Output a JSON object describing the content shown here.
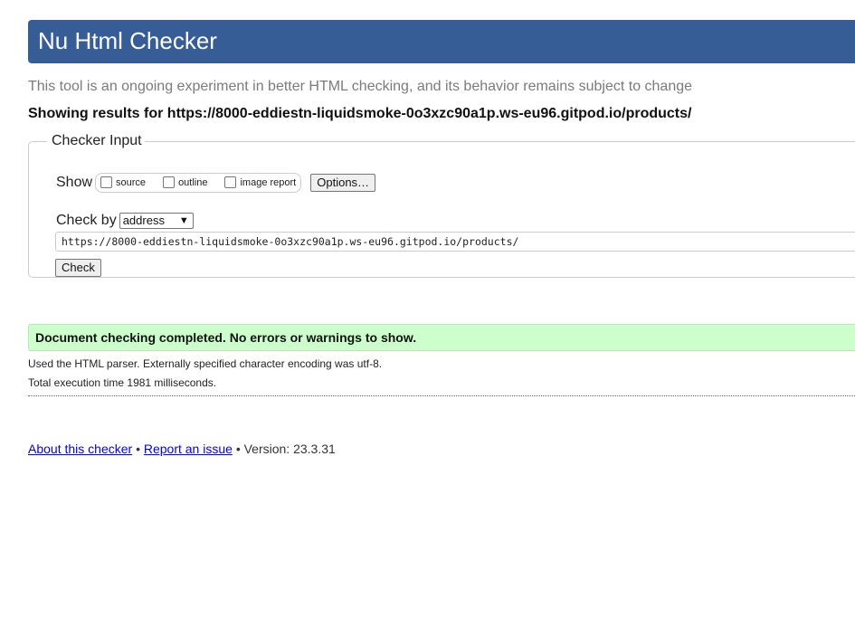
{
  "header": {
    "title": "Nu Html Checker"
  },
  "intro": "This tool is an ongoing experiment in better HTML checking, and its behavior remains subject to change",
  "results_heading": "Showing results for https://8000-eddiestn-liquidsmoke-0o3xzc90a1p.ws-eu96.gitpod.io/products/",
  "checker_input": {
    "legend": "Checker Input",
    "show_label": "Show",
    "checkboxes": [
      {
        "label": "source",
        "checked": false
      },
      {
        "label": "outline",
        "checked": false
      },
      {
        "label": "image report",
        "checked": false
      }
    ],
    "options_button": "Options…",
    "check_by_label": "Check by",
    "check_by_value": "address",
    "url_value": "https://8000-eddiestn-liquidsmoke-0o3xzc90a1p.ws-eu96.gitpod.io/products/",
    "check_button": "Check"
  },
  "result": {
    "message": "Document checking completed. No errors or warnings to show.",
    "message_bg": "#ccffcc",
    "parser_info": "Used the HTML parser. Externally specified character encoding was utf-8.",
    "exec_time": "Total execution time 1981 milliseconds."
  },
  "footer": {
    "about_link": "About this checker",
    "separator": "•",
    "report_link": "Report an issue",
    "version": "Version: 23.3.31"
  },
  "colors": {
    "header_bg": "#365d95",
    "link": "#0000ee"
  }
}
